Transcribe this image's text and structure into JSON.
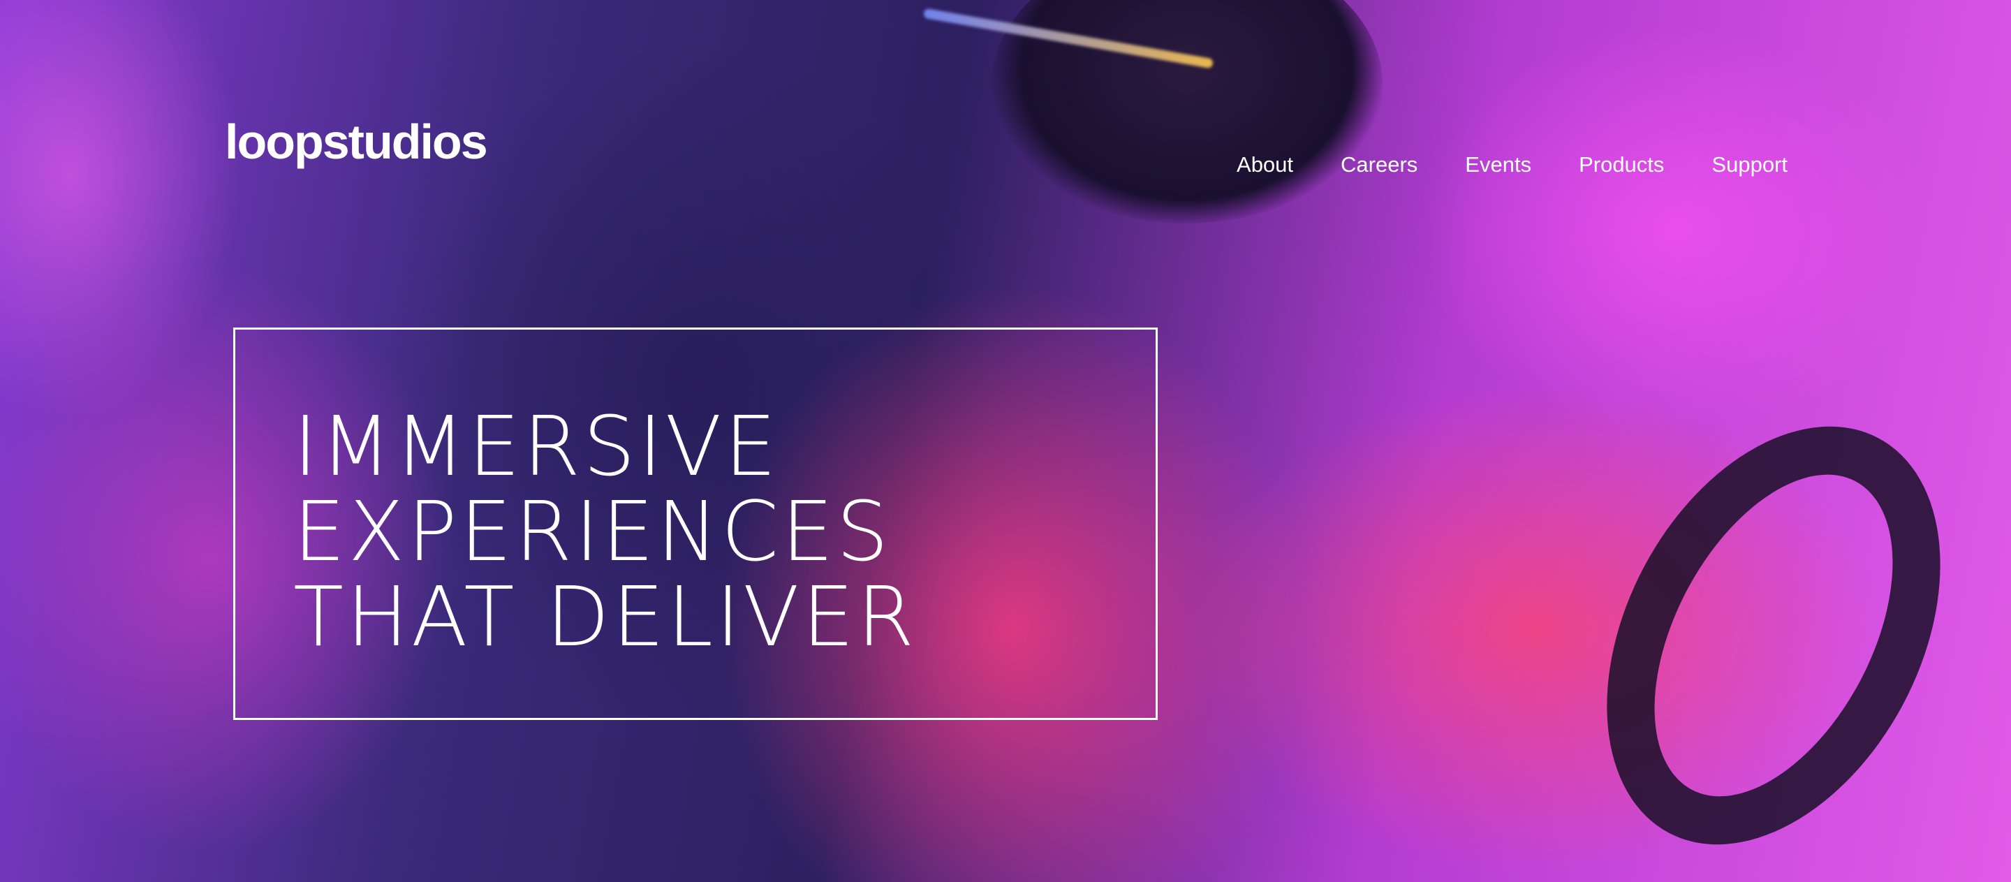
{
  "brand": {
    "logo_text": "loopstudios"
  },
  "nav": {
    "items": [
      {
        "label": "About"
      },
      {
        "label": "Careers"
      },
      {
        "label": "Events"
      },
      {
        "label": "Products"
      },
      {
        "label": "Support"
      }
    ]
  },
  "hero": {
    "headline_lines": [
      "IMMERSIVE",
      "EXPERIENCES",
      "THAT DELIVER"
    ],
    "background_description_colors": {
      "primary": "#e25ae8",
      "secondary": "#ff4682",
      "dark": "#2c2060"
    }
  }
}
